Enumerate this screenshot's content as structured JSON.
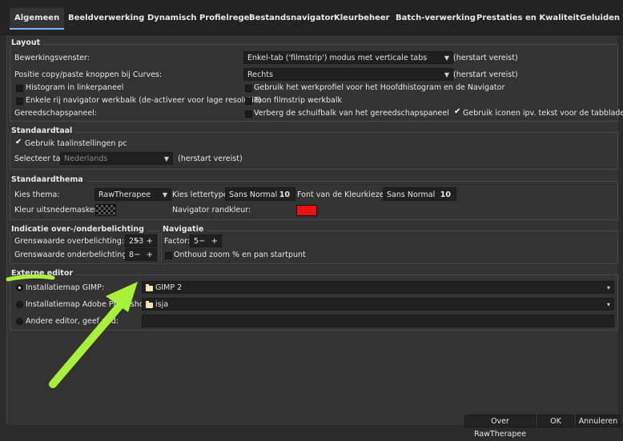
{
  "tabs": [
    {
      "label": "Algemeen"
    },
    {
      "label": "Beeldverwerking"
    },
    {
      "label": "Dynamisch Profielregel"
    },
    {
      "label": "Bestandsnavigator"
    },
    {
      "label": "Kleurbeheer"
    },
    {
      "label": "Batch-verwerking"
    },
    {
      "label": "Prestaties en Kwaliteit"
    },
    {
      "label": "Geluiden"
    }
  ],
  "layout": {
    "title": "Layout",
    "editor_window_label": "Bewerkingsvenster:",
    "editor_window_value": "Enkel-tab ('filmstrip') modus met verticale tabs",
    "restart1": "(herstart vereist)",
    "curves_label": "Positie copy/paste knoppen bij Curves:",
    "curves_value": "Rechts",
    "restart2": "(herstart vereist)",
    "histogram_left": "Histogram in linkerpaneel",
    "working_profile": "Gebruik het werkprofiel voor het Hoofdhistogram en de Navigator",
    "single_row": "Enkele rij navigator werkbalk (de-activeer voor lage resolutie)",
    "filmstrip": "Toon filmstrip werkbalk",
    "toolpanel_label": "Gereedschapspaneel:",
    "hide_scrollbar": "Verberg de schuifbalk van het gereedschapspaneel",
    "use_icons": "Gebruik iconen ipv. tekst voor de tabbladen"
  },
  "language": {
    "title": "Standaardtaal",
    "use_system": "Gebruik taalinstellingen pc",
    "select_label": "Selecteer taal:",
    "select_value": "Nederlands",
    "restart": "(herstart vereist)"
  },
  "theme": {
    "title": "Standaardthema",
    "theme_label": "Kies thema:",
    "theme_value": "RawTherapee",
    "font_label": "Kies lettertype",
    "font_name": "Sans Normal",
    "font_size": "10",
    "picker_font_label": "Font van de Kleurkiezer:",
    "picker_font_name": "Sans Normal",
    "picker_font_size": "10",
    "cutout_label": "Kleur uitsnedemasker:",
    "nav_border_label": "Navigator randkleur:",
    "nav_border_color": "#e81414"
  },
  "clipping": {
    "title": "Indicatie over-/onderbelichting",
    "over_label": "Grenswaarde overbelichting:",
    "over_value": "253",
    "under_label": "Grenswaarde onderbelichting:",
    "under_value": "8",
    "pm": "− +"
  },
  "navigation": {
    "title": "Navigatie",
    "factor_label": "Factor:",
    "factor_value": "5",
    "pm": "− +",
    "remember_zoom": "Onthoud zoom % en pan startpunt"
  },
  "external_editor": {
    "title": "Externe editor",
    "gimp_label": "Installatiemap GIMP:",
    "gimp_value": "GIMP 2",
    "photoshop_label": "Installatiemap Adobe Photoshop:",
    "photoshop_value": "isja",
    "other_label": "Andere editor, geef pad:"
  },
  "footer": {
    "about": "Over RawTherapee",
    "ok": "OK",
    "cancel": "Annuleren"
  },
  "colors": {
    "annotation_arrow": "#a8f03a",
    "active_tab": "#7ab0ff"
  }
}
